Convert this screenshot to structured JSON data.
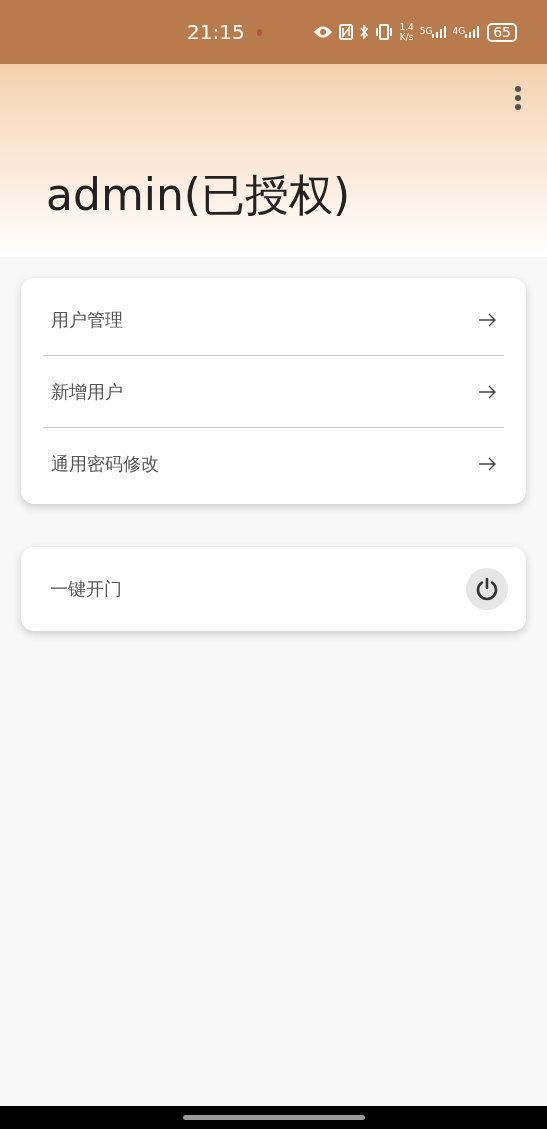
{
  "status_bar": {
    "time": "21:15",
    "speed_value": "1.4",
    "speed_unit": "K/s",
    "networks": [
      "5G",
      "4G"
    ],
    "battery": "65"
  },
  "header": {
    "title": "admin(已授权)"
  },
  "menu": [
    {
      "label": "用户管理"
    },
    {
      "label": "新增用户"
    },
    {
      "label": "通用密码修改"
    }
  ],
  "actions": [
    {
      "label": "一键开门"
    }
  ]
}
